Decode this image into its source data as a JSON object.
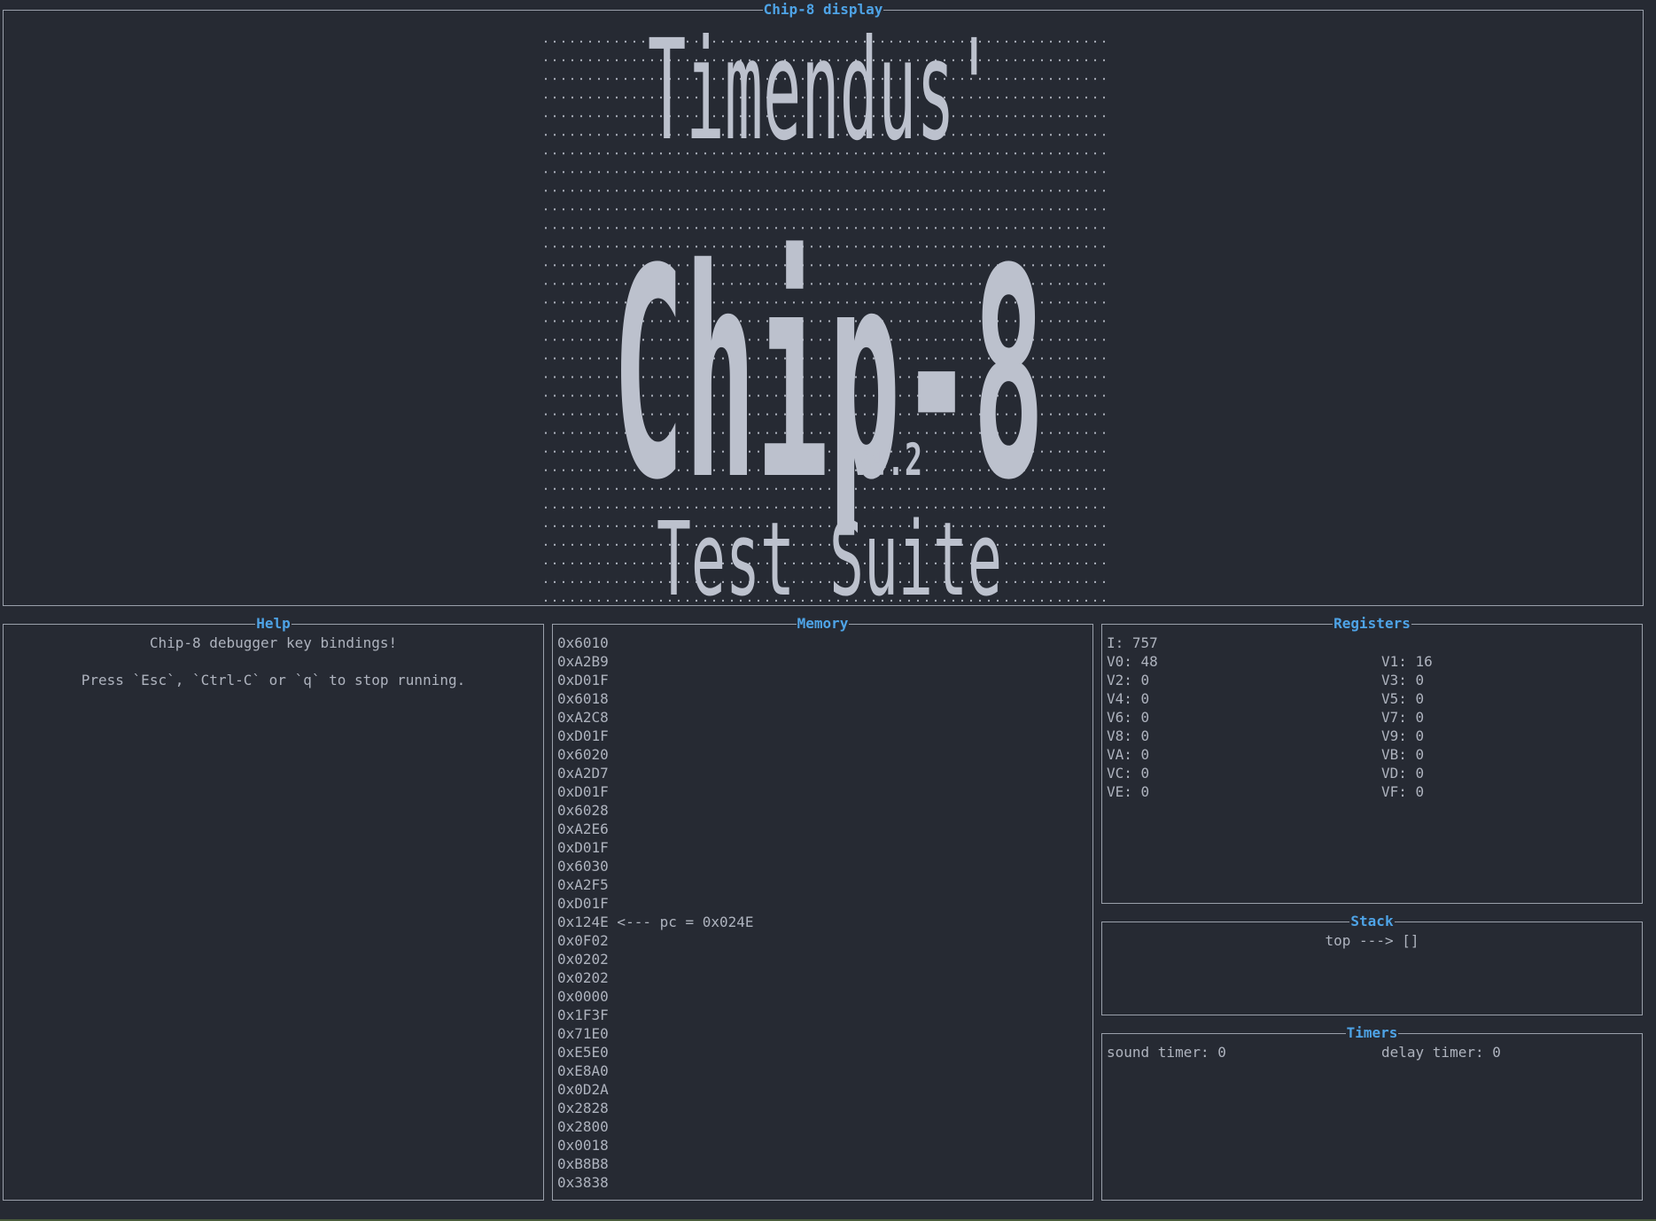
{
  "display": {
    "title": "Chip-8 display",
    "screen_text": [
      "Timendus'",
      "Chip-8",
      "v4.2",
      "Test Suite"
    ],
    "pixel_color": "#bcc1cd",
    "dot_color": "#aeb3be"
  },
  "help": {
    "title": "Help",
    "lines": [
      "Chip-8 debugger key bindings!",
      "",
      "Press `Esc`, `Ctrl-C` or `q` to stop running."
    ]
  },
  "memory": {
    "title": "Memory",
    "lines": [
      "0x6010",
      "0xA2B9",
      "0xD01F",
      "0x6018",
      "0xA2C8",
      "0xD01F",
      "0x6020",
      "0xA2D7",
      "0xD01F",
      "0x6028",
      "0xA2E6",
      "0xD01F",
      "0x6030",
      "0xA2F5",
      "0xD01F",
      "0x124E <--- pc = 0x024E",
      "0x0F02",
      "0x0202",
      "0x0202",
      "0x0000",
      "0x1F3F",
      "0x71E0",
      "0xE5E0",
      "0xE8A0",
      "0x0D2A",
      "0x2828",
      "0x2800",
      "0x0018",
      "0xB8B8",
      "0x3838"
    ]
  },
  "registers": {
    "title": "Registers",
    "i": "I: 757",
    "left": [
      "V0: 48",
      "V2: 0",
      "V4: 0",
      "V6: 0",
      "V8: 0",
      "VA: 0",
      "VC: 0",
      "VE: 0"
    ],
    "right": [
      "V1: 16",
      "V3: 0",
      "V5: 0",
      "V7: 0",
      "V9: 0",
      "VB: 0",
      "VD: 0",
      "VF: 0"
    ]
  },
  "stack": {
    "title": "Stack",
    "content": "top ---> []"
  },
  "timers": {
    "title": "Timers",
    "sound": "sound timer: 0",
    "delay": "delay timer: 0"
  }
}
